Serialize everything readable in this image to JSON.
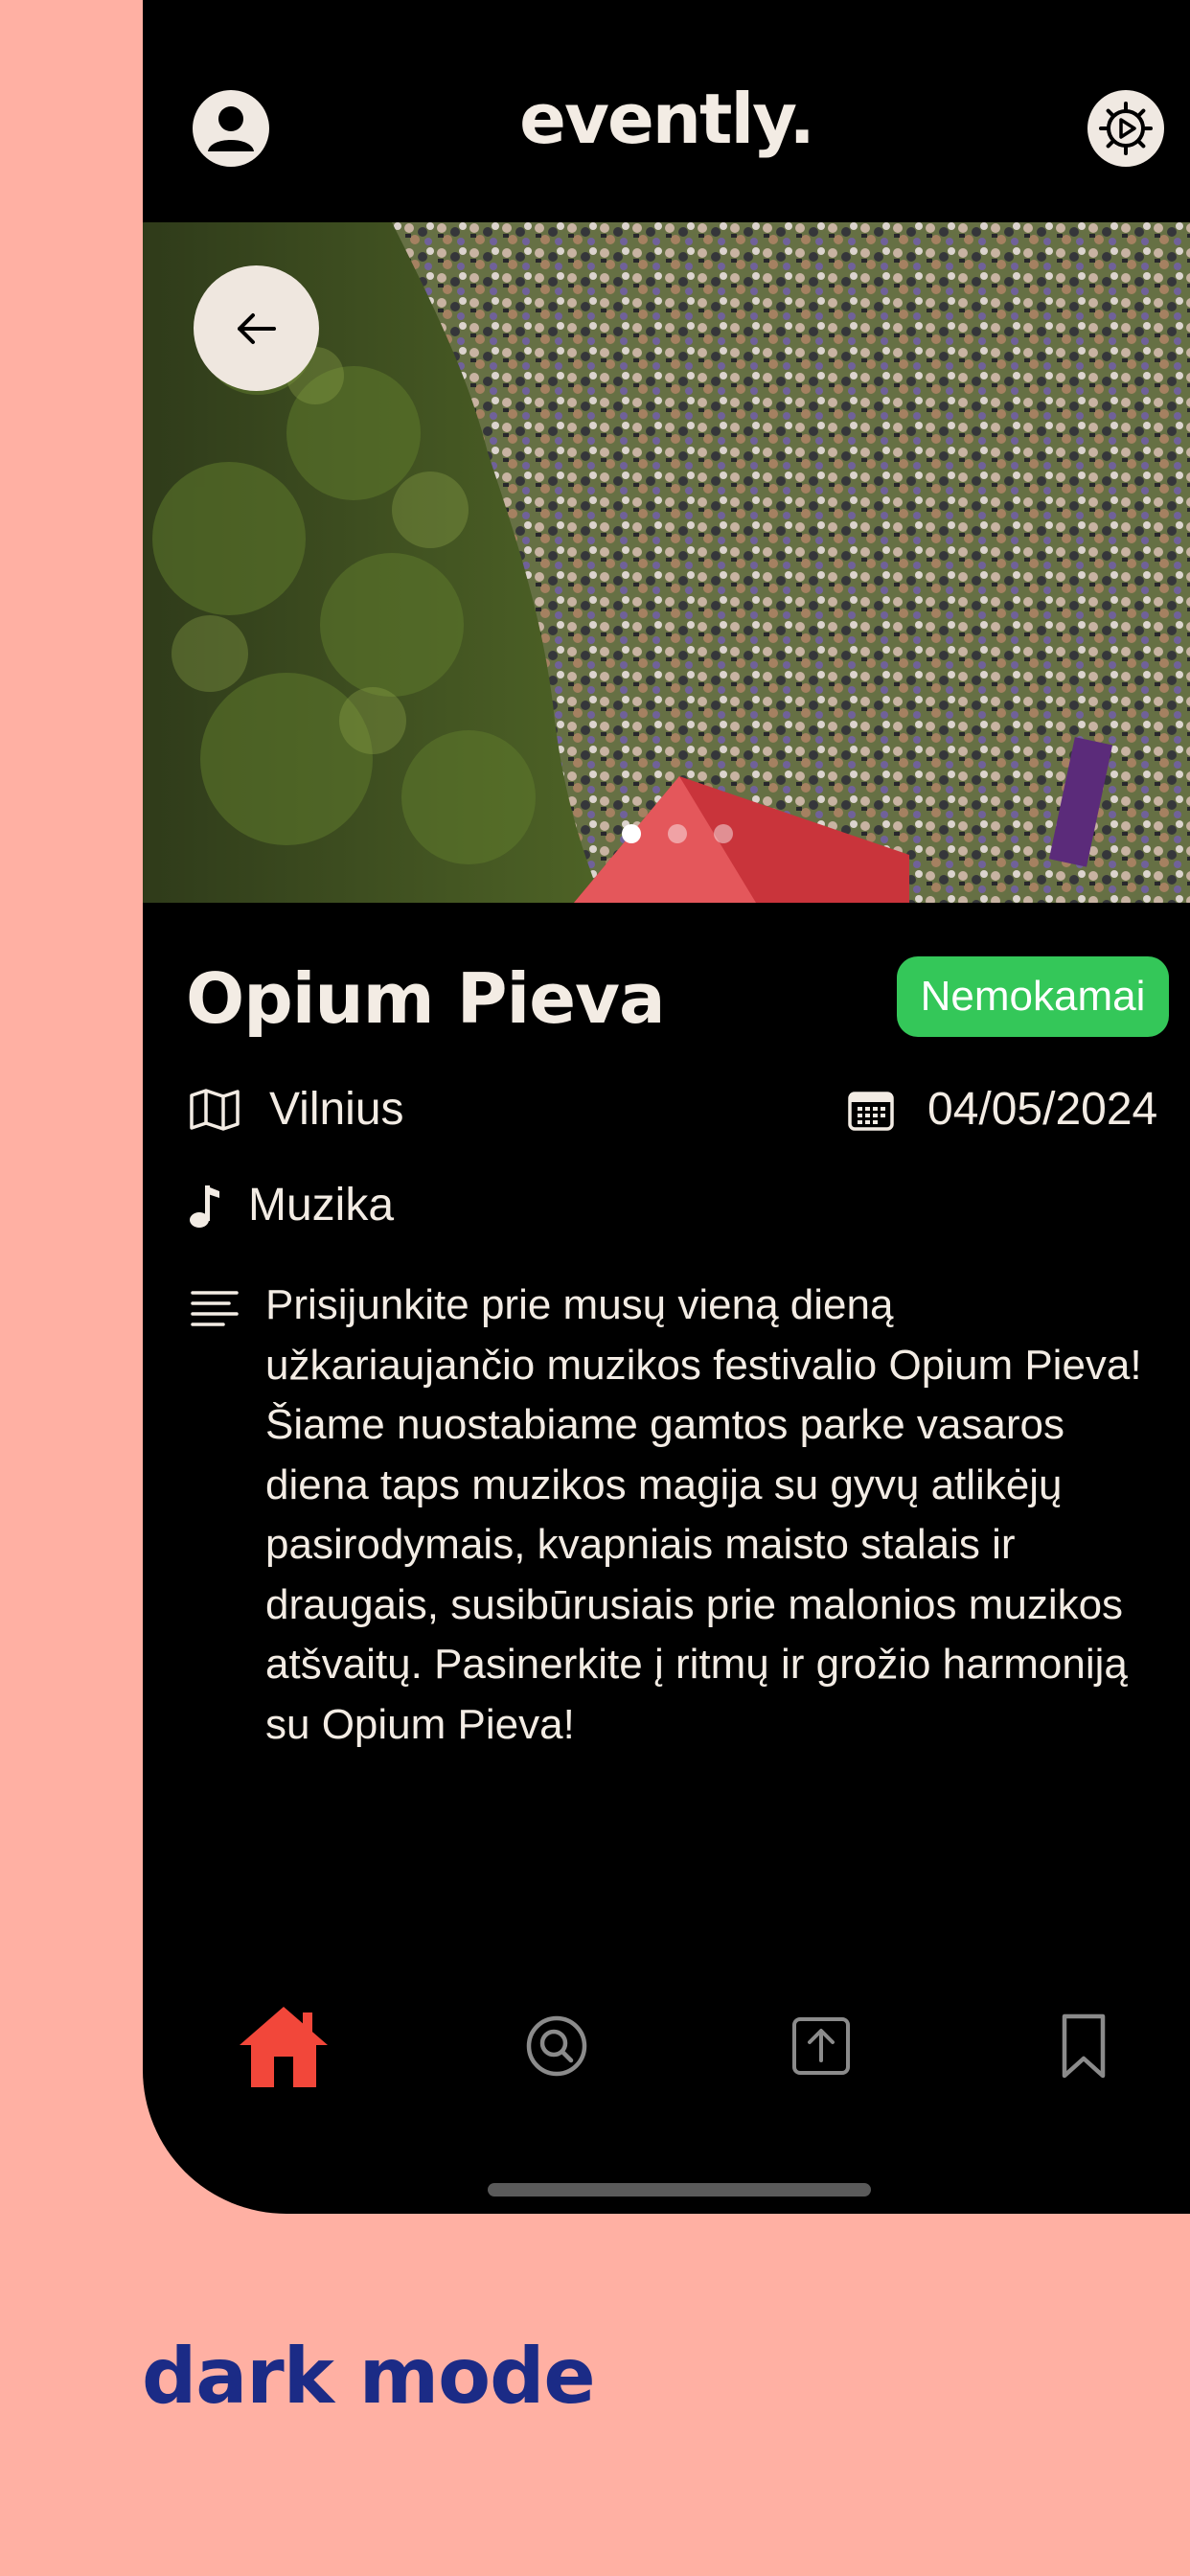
{
  "header": {
    "brand": "evently.",
    "avatar_icon": "user-avatar-icon",
    "settings_icon": "gear-icon"
  },
  "hero": {
    "image_description_icon": "festival-crowd-photo",
    "carousel_total": 3,
    "carousel_active": 1,
    "back_icon": "arrow-left-icon"
  },
  "event": {
    "title": "Opium Pieva",
    "badge": "Nemokamai",
    "city": "Vilnius",
    "date": "04/05/2024",
    "category": "Muzika",
    "description": "Prisijunkite prie musų vieną dieną užkariaujančio muzikos festivalio Opium Pieva! Šiame nuostabiame gamtos parke vasaros diena taps muzikos magija su gyvų atlikėjų pasirodymais, kvapniais maisto stalais ir draugais, susibūrusiais prie malonios muzikos atšvaitų. Pasinerkite į ritmų ir grožio harmoniją su Opium Pieva!"
  },
  "tabbar": {
    "items": [
      {
        "name": "home",
        "icon": "home-icon",
        "active": true
      },
      {
        "name": "search",
        "icon": "search-icon",
        "active": false
      },
      {
        "name": "upload",
        "icon": "upload-icon",
        "active": false
      },
      {
        "name": "saved",
        "icon": "bookmark-icon",
        "active": false
      }
    ]
  },
  "caption": "dark mode",
  "colors": {
    "background": "#FFB0A3",
    "screen": "#000000",
    "text": "#F3ECE4",
    "badge": "#34C759",
    "accent_active": "#F2473A",
    "caption": "#1B2B86"
  }
}
